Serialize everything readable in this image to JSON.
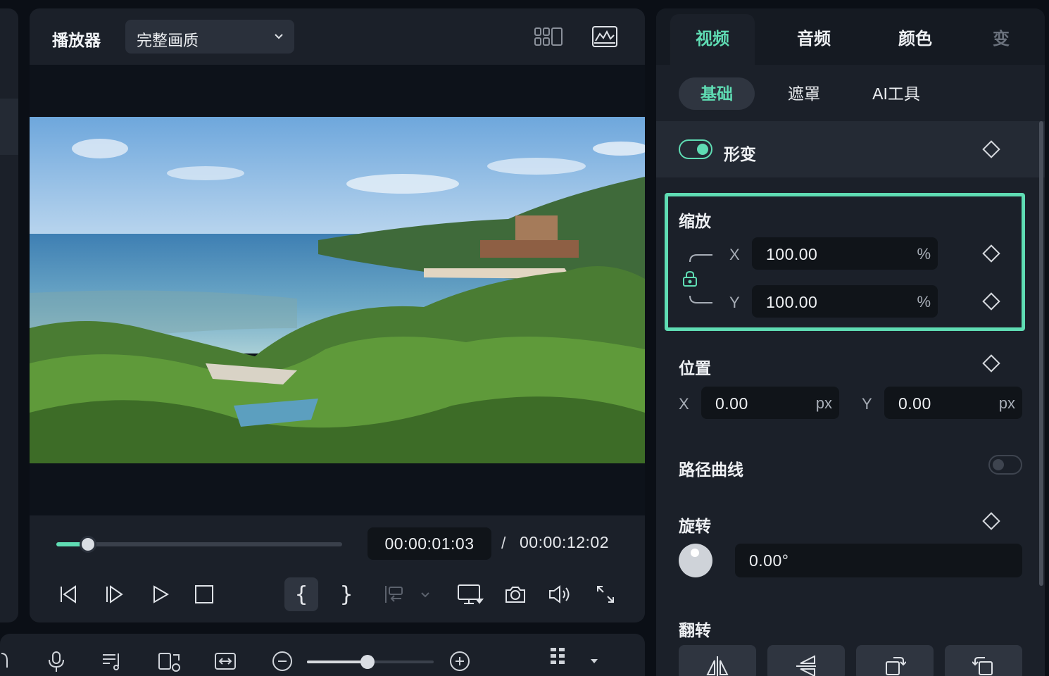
{
  "colors": {
    "accent": "#5fdcb3",
    "panel": "#1b2029",
    "field": "#101419"
  },
  "player": {
    "title": "播放器",
    "quality_value": "完整画质",
    "progress_fraction": 0.11,
    "time_current": "00:00:01:03",
    "time_separator": "/",
    "time_total": "00:00:12:02",
    "mark_in": "{",
    "mark_out": "}"
  },
  "timeline": {
    "zoom_fraction": 0.48
  },
  "inspector": {
    "tabs": [
      {
        "label": "视频"
      },
      {
        "label": "音频"
      },
      {
        "label": "颜色"
      },
      {
        "label": "变"
      }
    ],
    "subtabs": [
      {
        "label": "基础"
      },
      {
        "label": "遮罩"
      },
      {
        "label": "AI工具"
      }
    ],
    "transform": {
      "label": "形变",
      "enabled": true
    },
    "scale": {
      "label": "缩放",
      "x_axis": "X",
      "x_value": "100.00",
      "x_unit": "%",
      "y_axis": "Y",
      "y_value": "100.00",
      "y_unit": "%"
    },
    "position": {
      "label": "位置",
      "x_axis": "X",
      "x_value": "0.00",
      "x_unit": "px",
      "y_axis": "Y",
      "y_value": "0.00",
      "y_unit": "px"
    },
    "path_curve": {
      "label": "路径曲线",
      "enabled": false
    },
    "rotate": {
      "label": "旋转",
      "value": "0.00°"
    },
    "flip": {
      "label": "翻转"
    }
  }
}
